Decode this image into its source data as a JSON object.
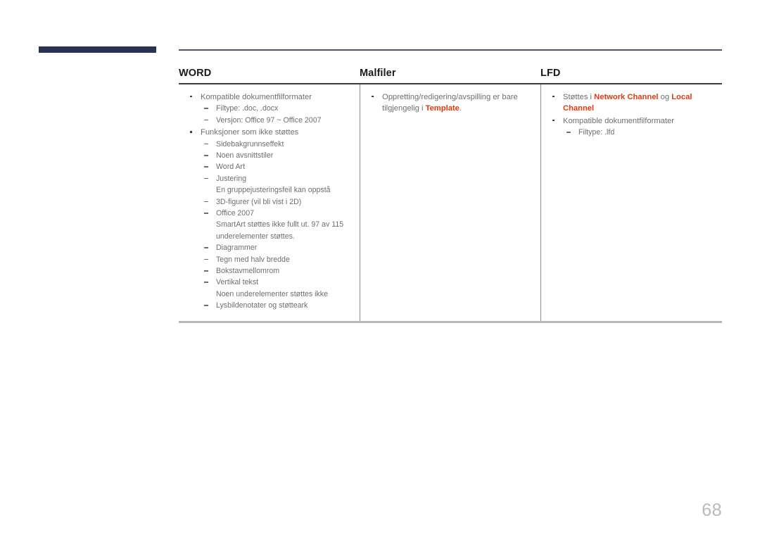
{
  "page": {
    "number": "68",
    "accent_navy": "#2b3355",
    "highlight_red": "#e5380d",
    "body_text_color": "#6e6e6e"
  },
  "table": {
    "headers": [
      {
        "label": "WORD"
      },
      {
        "label": "Malfiler"
      },
      {
        "label": "LFD"
      }
    ],
    "columns": [
      {
        "key": "word",
        "items": [
          {
            "text": "Kompatible dokumentfilformater",
            "sub": [
              {
                "text": "Filtype: .doc, .docx"
              },
              {
                "text": "Versjon: Office 97 ~ Office 2007"
              }
            ]
          },
          {
            "text": "Funksjoner som ikke støttes",
            "sub": [
              {
                "text": "Sidebakgrunnseffekt"
              },
              {
                "text": "Noen avsnittstiler"
              },
              {
                "text": "Word Art"
              },
              {
                "text": "Justering",
                "note": "En gruppejusteringsfeil kan oppstå"
              },
              {
                "text": "3D-figurer (vil bli vist i 2D)"
              },
              {
                "text": "Office 2007",
                "note": "SmartArt støttes ikke fullt ut. 97 av 115 underelementer støttes."
              },
              {
                "text": "Diagrammer"
              },
              {
                "text": "Tegn med halv bredde"
              },
              {
                "text": "Bokstavmellomrom"
              },
              {
                "text": "Vertikal tekst",
                "note": "Noen underelementer støttes ikke"
              },
              {
                "text": "Lysbildenotater og støtteark"
              }
            ]
          }
        ]
      },
      {
        "key": "malfiler",
        "items": [
          {
            "parts": [
              {
                "t": "Oppretting/redigering/avspilling er bare tilgjengelig i ",
                "hl": false
              },
              {
                "t": "Template",
                "hl": true
              },
              {
                "t": ".",
                "hl": false
              }
            ],
            "sub": []
          }
        ]
      },
      {
        "key": "lfd",
        "items": [
          {
            "parts": [
              {
                "t": "Støttes i ",
                "hl": false
              },
              {
                "t": "Network Channel",
                "hl": true
              },
              {
                "t": " og ",
                "hl": false
              },
              {
                "t": "Local Channel",
                "hl": true
              }
            ],
            "sub": []
          },
          {
            "text": "Kompatible dokumentfilformater",
            "sub": [
              {
                "text": "Filtype: .lfd"
              }
            ]
          }
        ]
      }
    ]
  }
}
